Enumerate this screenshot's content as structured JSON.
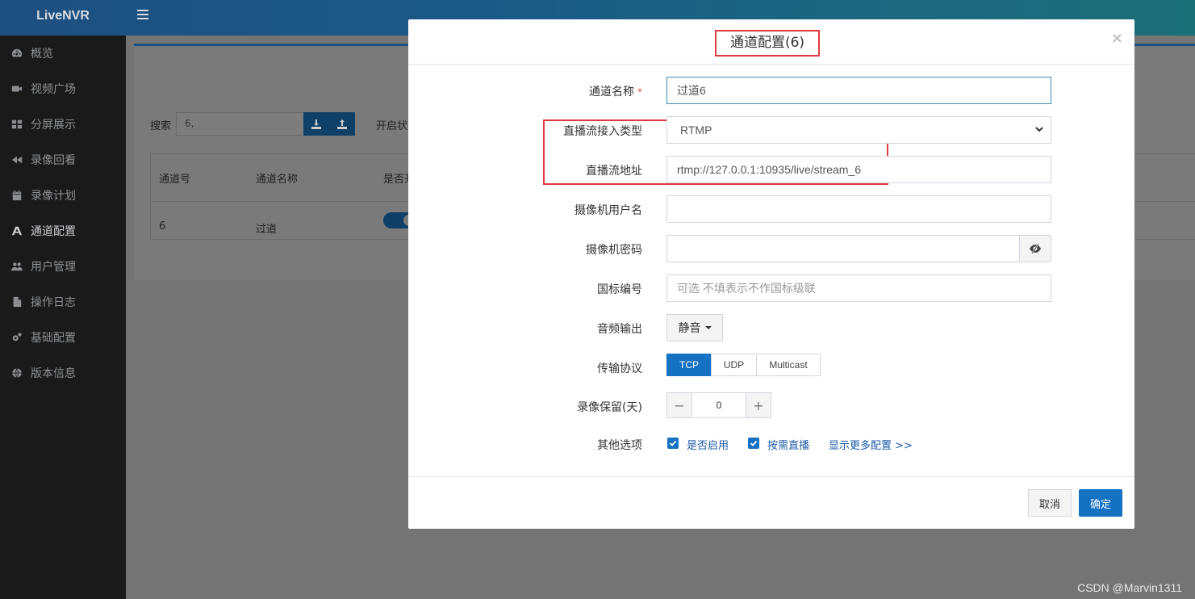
{
  "app": {
    "brand": "LiveNVR"
  },
  "sidebar": {
    "items": [
      {
        "label": "概览",
        "icon": "dashboard-icon"
      },
      {
        "label": "视频广场",
        "icon": "video-camera-icon"
      },
      {
        "label": "分屏展示",
        "icon": "grid-icon"
      },
      {
        "label": "录像回看",
        "icon": "rewind-icon"
      },
      {
        "label": "录像计划",
        "icon": "calendar-icon"
      },
      {
        "label": "通道配置",
        "icon": "sitemap-icon"
      },
      {
        "label": "用户管理",
        "icon": "users-icon"
      },
      {
        "label": "操作日志",
        "icon": "file-icon"
      },
      {
        "label": "基础配置",
        "icon": "cogs-icon"
      },
      {
        "label": "版本信息",
        "icon": "globe-icon"
      }
    ]
  },
  "background": {
    "search_label": "搜索",
    "search_value": "6,",
    "status_label": "开启状态",
    "columns": [
      "通道号",
      "通道名称",
      "是否开"
    ],
    "rows": [
      {
        "id": "6",
        "name": "过道"
      }
    ]
  },
  "modal": {
    "title": "通道配置(6)",
    "close": "×",
    "fields": {
      "channel_name_label": "通道名称",
      "required_mark": "*",
      "channel_name_value": "过道6",
      "stream_type_label": "直播流接入类型",
      "stream_type_value": "RTMP",
      "stream_url_label": "直播流地址",
      "stream_url_value": "rtmp://127.0.0.1:10935/live/stream_6",
      "camera_user_label": "摄像机用户名",
      "camera_user_value": "",
      "camera_password_label": "摄像机密码",
      "camera_password_value": "",
      "gb_id_label": "国标编号",
      "gb_id_placeholder": "可选 不填表示不作国标级联",
      "audio_label": "音频输出",
      "audio_value": "静音",
      "protocol_label": "传输协议",
      "protocol_options": [
        "TCP",
        "UDP",
        "Multicast"
      ],
      "protocol_selected": "TCP",
      "retention_label": "录像保留(天)",
      "retention_value": "0",
      "retention_minus": "−",
      "retention_plus": "+",
      "other_label": "其他选项",
      "enabled_label": "是否启用",
      "enabled_checked": true,
      "on_demand_label": "按需直播",
      "on_demand_checked": true,
      "more_link": "显示更多配置 >>"
    },
    "buttons": {
      "cancel": "取消",
      "ok": "确定"
    }
  },
  "watermark": "CSDN @Marvin1311",
  "colors": {
    "primary": "#1571c2",
    "highlight": "#e03a3a",
    "sidebar_bg": "#1a1a1a"
  }
}
